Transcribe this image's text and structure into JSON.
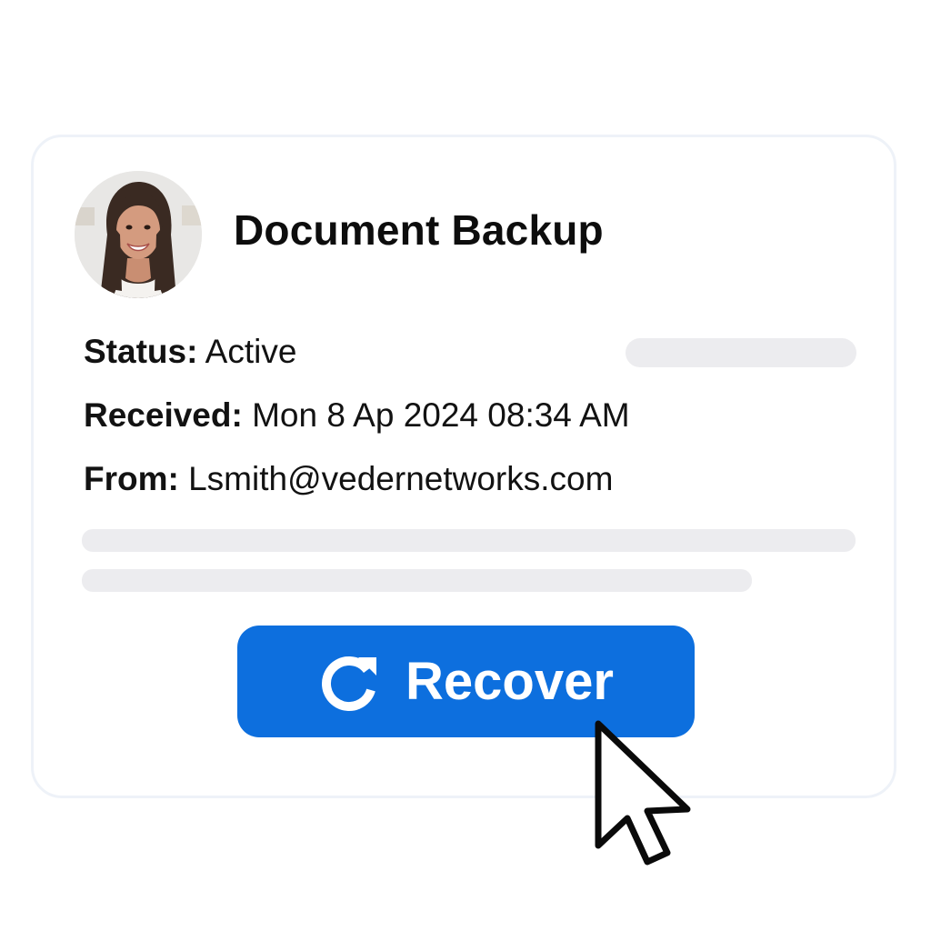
{
  "card": {
    "title": "Document Backup",
    "avatar": "user-avatar-photo",
    "fields": {
      "status": {
        "label": "Status:",
        "value": "Active"
      },
      "received": {
        "label": "Received:",
        "value": "Mon 8 Ap 2024 08:34 AM"
      },
      "from": {
        "label": "From:",
        "value": "Lsmith@vedernetworks.com"
      }
    }
  },
  "actions": {
    "recover_label": "Recover",
    "recover_icon": "refresh-icon"
  },
  "pointer_icon": "mouse-cursor-icon",
  "colors": {
    "accent": "#0d6fde",
    "placeholder": "#ececef",
    "card_border": "#eef2f8",
    "text": "#121212"
  }
}
